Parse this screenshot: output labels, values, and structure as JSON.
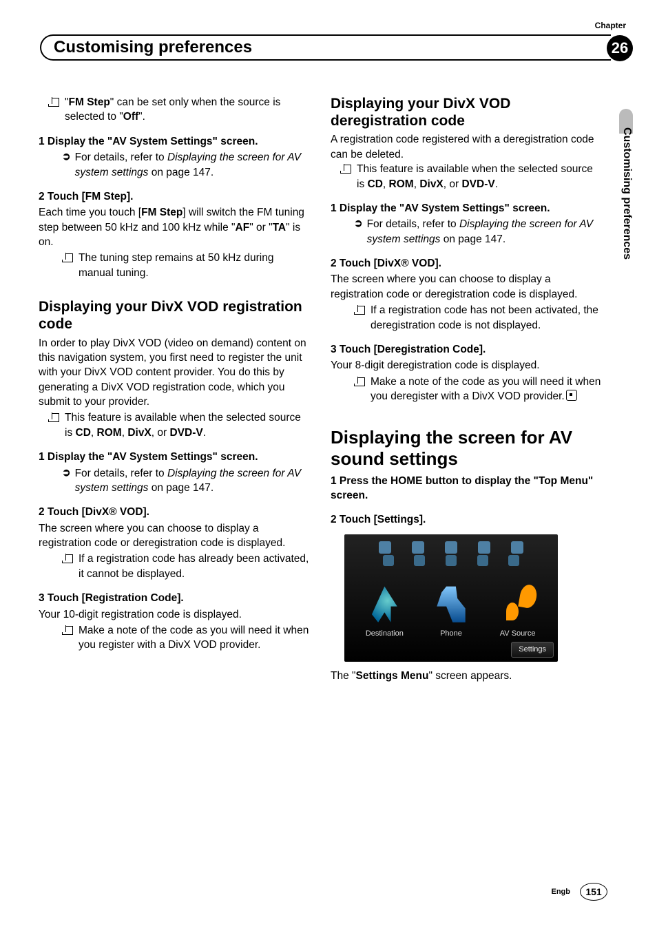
{
  "chapter": {
    "label": "Chapter",
    "title": "Customising preferences",
    "number": "26",
    "side_tab": "Customising preferences"
  },
  "left": {
    "b1": {
      "pre": "\"",
      "bold1": "FM Step",
      "mid": "\" can be set only when the source is selected to \"",
      "bold2": "Off",
      "post": "\"."
    },
    "s1_head": "1   Display the \"AV System Settings\" screen.",
    "s1_ref": {
      "pre": "For details, refer to ",
      "em": "Displaying the screen for AV system settings",
      "post": " on page 147."
    },
    "s2_head": "2   Touch [FM Step].",
    "s2_body": {
      "t1": "Each time you touch [",
      "b1": "FM Step",
      "t2": "] will switch the FM tuning step between 50 kHz and 100 kHz while \"",
      "b2": "AF",
      "t3": "\" or \"",
      "b3": "TA",
      "t4": "\" is on."
    },
    "s2_note": "The tuning step remains at 50 kHz during manual tuning.",
    "h1": "Displaying your DivX VOD registration code",
    "p1": "In order to play DivX VOD (video on demand) content on this navigation system, you first need to register the unit with your DivX VOD content provider. You do this by generating a DivX VOD registration code, which you submit to your provider.",
    "b2": {
      "t1": "This feature is available when the selected source is ",
      "b1": "CD",
      "c1": ", ",
      "b2": "ROM",
      "c2": ", ",
      "b3": "DivX",
      "c3": ", or ",
      "b4": "DVD-V",
      "t2": "."
    },
    "s3_head": "1   Display the \"AV System Settings\" screen.",
    "s3_ref": {
      "pre": "For details, refer to ",
      "em": "Displaying the screen for AV system settings",
      "post": " on page 147."
    },
    "s4_head": "2   Touch [DivX® VOD].",
    "s4_body": "The screen where you can choose to display a registration code or deregistration code is displayed.",
    "s4_note": "If a registration code has already been activated, it cannot be displayed.",
    "s5_head": "3   Touch [Registration Code].",
    "s5_body": "Your 10-digit registration code is displayed.",
    "s5_note": "Make a note of the code as you will need it when you register with a DivX VOD provider."
  },
  "right": {
    "h1": "Displaying your DivX VOD deregistration code",
    "p1": "A registration code registered with a deregistration code can be deleted.",
    "b1": {
      "t1": "This feature is available when the selected source is ",
      "b1": "CD",
      "c1": ", ",
      "b2": "ROM",
      "c2": ", ",
      "b3": "DivX",
      "c3": ", or ",
      "b4": "DVD-V",
      "t2": "."
    },
    "s1_head": "1   Display the \"AV System Settings\" screen.",
    "s1_ref": {
      "pre": "For details, refer to ",
      "em": "Displaying the screen for AV system settings",
      "post": " on page 147."
    },
    "s2_head": "2   Touch [DivX® VOD].",
    "s2_body": "The screen where you can choose to display a registration code or deregistration code is displayed.",
    "s2_note": "If a registration code has not been activated, the deregistration code is not displayed.",
    "s3_head": "3   Touch [Deregistration Code].",
    "s3_body": "Your 8-digit deregistration code is displayed.",
    "s3_note": "Make a note of the code as you will need it when you deregister with a DivX VOD provider.",
    "h2": "Displaying the screen for AV sound settings",
    "s4_head": "1   Press the HOME button to display the \"Top Menu\" screen.",
    "s5_head": "2   Touch [Settings].",
    "shot": {
      "destination": "Destination",
      "phone": "Phone",
      "av": "AV Source",
      "settings": "Settings"
    },
    "p2": {
      "t1": "The \"",
      "b1": "Settings Menu",
      "t2": "\" screen appears."
    }
  },
  "footer": {
    "lang": "Engb",
    "page": "151"
  }
}
